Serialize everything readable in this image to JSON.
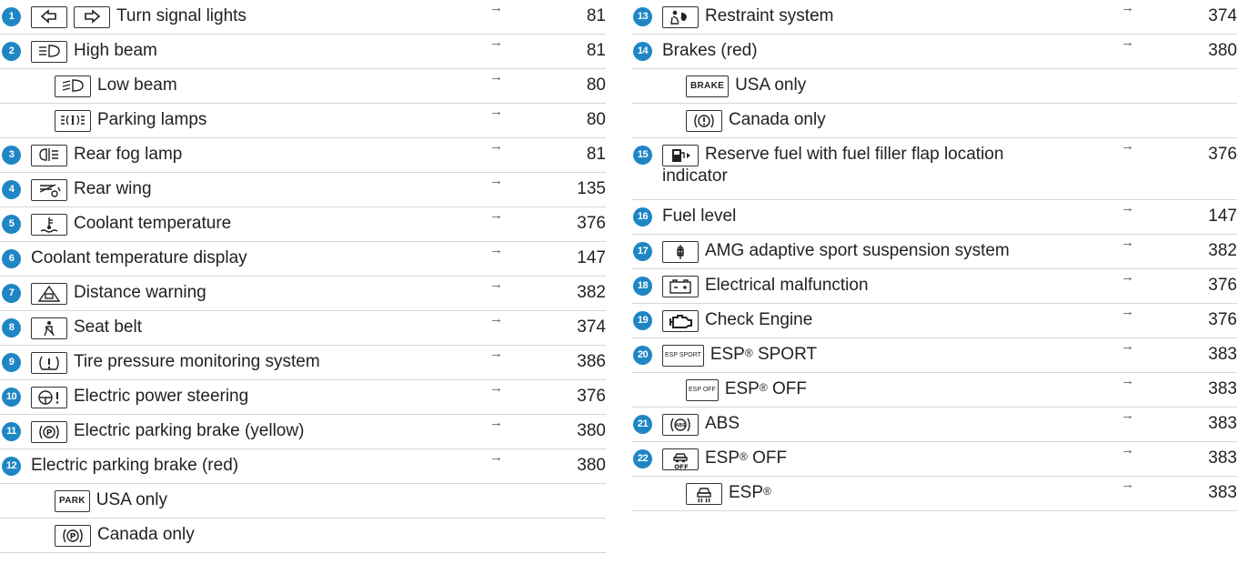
{
  "arrow": "→",
  "left_rows": [
    {
      "num": "1",
      "icon": "turn-signal-left-right-icon",
      "label": "Turn signal lights",
      "page": "81"
    },
    {
      "num": "2",
      "icon": "high-beam-icon",
      "label": "High beam",
      "page": "81"
    },
    {
      "num": "",
      "icon": "low-beam-icon",
      "label": "Low beam",
      "page": "80"
    },
    {
      "num": "",
      "icon": "parking-lamps-icon",
      "label": "Parking lamps",
      "page": "80"
    },
    {
      "num": "3",
      "icon": "rear-fog-lamp-icon",
      "label": "Rear fog lamp",
      "page": "81"
    },
    {
      "num": "4",
      "icon": "rear-wing-icon",
      "label": "Rear wing",
      "page": "135"
    },
    {
      "num": "5",
      "icon": "coolant-temperature-icon",
      "label": "Coolant temperature",
      "page": "376"
    },
    {
      "num": "6",
      "icon": "",
      "label": "Coolant temperature display",
      "page": "147"
    },
    {
      "num": "7",
      "icon": "distance-warning-icon",
      "label": "Distance warning",
      "page": "382"
    },
    {
      "num": "8",
      "icon": "seat-belt-icon",
      "label": "Seat belt",
      "page": "374"
    },
    {
      "num": "9",
      "icon": "tire-pressure-icon",
      "label": "Tire pressure monitoring system",
      "page": "386"
    },
    {
      "num": "10",
      "icon": "power-steering-icon",
      "label": "Electric power steering",
      "page": "376"
    },
    {
      "num": "11",
      "icon": "parking-brake-icon",
      "label": "Electric parking brake (yellow)",
      "page": "380"
    },
    {
      "num": "12",
      "icon": "",
      "label": "Electric parking brake (red)",
      "page": "380"
    },
    {
      "num": "",
      "icon": "park-text-icon",
      "icon_text": "PARK",
      "label": "USA only",
      "page": ""
    },
    {
      "num": "",
      "icon": "parking-brake-icon",
      "label": "Canada only",
      "page": ""
    }
  ],
  "right_rows": [
    {
      "num": "13",
      "icon": "restraint-system-icon",
      "label": "Restraint system",
      "page": "374"
    },
    {
      "num": "14",
      "icon": "",
      "label": "Brakes (red)",
      "page": "380"
    },
    {
      "num": "",
      "icon": "brake-text-icon",
      "icon_text": "BRAKE",
      "label": "USA only",
      "page": ""
    },
    {
      "num": "",
      "icon": "brake-warning-icon",
      "label": "Canada only",
      "page": ""
    },
    {
      "num": "15",
      "icon": "reserve-fuel-icon",
      "label": "Reserve fuel with fuel filler flap location indicator",
      "page": "376"
    },
    {
      "num": "16",
      "icon": "",
      "label": "Fuel level",
      "page": "147"
    },
    {
      "num": "17",
      "icon": "adaptive-suspension-icon",
      "label": "AMG adaptive sport suspension system",
      "page": "382"
    },
    {
      "num": "18",
      "icon": "battery-icon",
      "label": "Electrical malfunction",
      "page": "376"
    },
    {
      "num": "19",
      "icon": "check-engine-icon",
      "label": "Check Engine",
      "page": "376"
    },
    {
      "num": "20",
      "icon": "esp-sport-text-icon",
      "icon_text": "ESP SPORT",
      "label": "ESP",
      "label_sup": "®",
      "label_tail": " SPORT",
      "page": "383"
    },
    {
      "num": "",
      "icon": "esp-off-text-icon",
      "icon_text": "ESP OFF",
      "label": "ESP",
      "label_sup": "®",
      "label_tail": " OFF",
      "page": "383"
    },
    {
      "num": "21",
      "icon": "abs-icon",
      "label": "ABS",
      "page": "383"
    },
    {
      "num": "22",
      "icon": "esp-off-car-icon",
      "label": "ESP",
      "label_sup": "®",
      "label_tail": " OFF",
      "page": "383"
    },
    {
      "num": "",
      "icon": "esp-car-skid-icon",
      "label": "ESP",
      "label_sup": "®",
      "page": "383"
    }
  ]
}
